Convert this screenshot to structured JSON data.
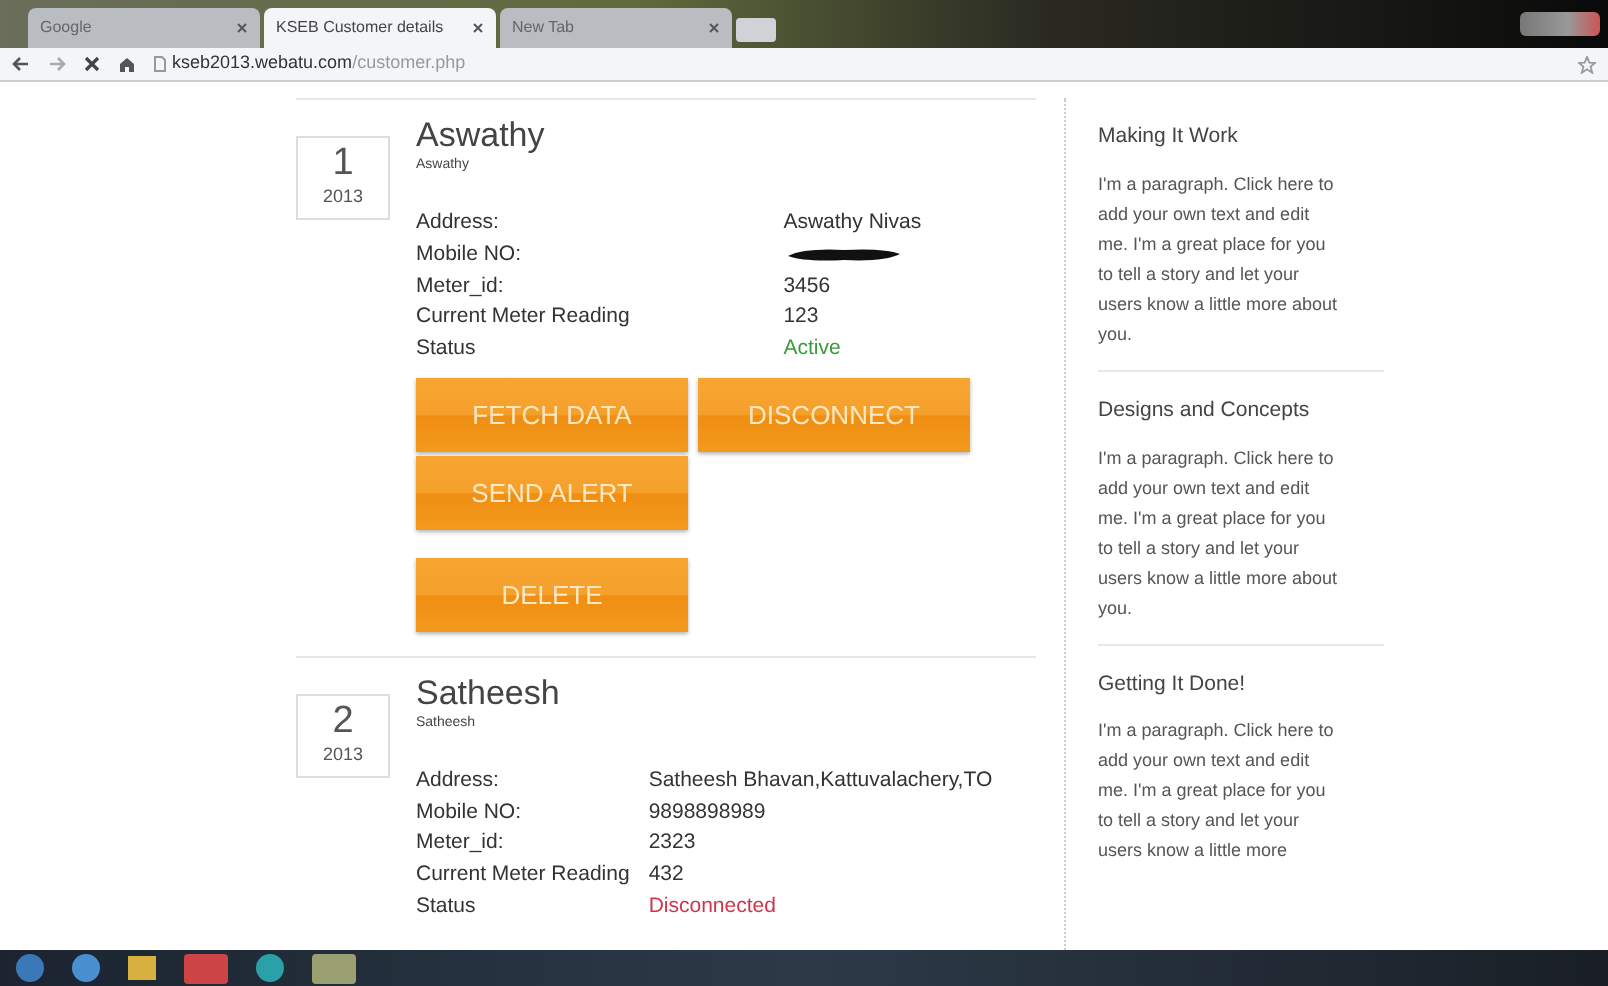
{
  "browser": {
    "tabs": [
      {
        "label": "Google",
        "selected": false
      },
      {
        "label": "KSEB Customer details",
        "selected": true
      },
      {
        "label": "New Tab",
        "selected": false
      }
    ],
    "address": {
      "host": "kseb2013.webatu.com",
      "path": "/customer.php"
    }
  },
  "customers": [
    {
      "number": "1",
      "year": "2013",
      "name": "Aswathy",
      "subname": "Aswathy",
      "fields": [
        {
          "label": "Address:",
          "value": "Aswathy Nivas",
          "kind": "text"
        },
        {
          "label": "Mobile NO:",
          "kind": "redacted"
        },
        {
          "label": "Meter_id:",
          "value": "3456",
          "kind": "text"
        },
        {
          "label": "Current Meter Reading",
          "value": "123",
          "kind": "text"
        },
        {
          "label": "Status",
          "value": "Active",
          "kind": "active"
        }
      ],
      "buttons": [
        "FETCH DATA",
        "DISCONNECT",
        "SEND ALERT",
        "DELETE"
      ]
    },
    {
      "number": "2",
      "year": "2013",
      "name": "Satheesh",
      "subname": "Satheesh",
      "fields": [
        {
          "label": "Address:",
          "value": "Satheesh Bhavan,Kattuvalachery,TO",
          "kind": "text"
        },
        {
          "label": "Mobile NO:",
          "value": "9898898989",
          "kind": "text"
        },
        {
          "label": "Meter_id:",
          "value": "2323",
          "kind": "text"
        },
        {
          "label": "Current Meter Reading",
          "value": "432",
          "kind": "text"
        },
        {
          "label": "Status",
          "value": "Disconnected",
          "kind": "disconnected"
        }
      ]
    }
  ],
  "sidebar": [
    {
      "title": "Making It Work",
      "text": "I'm a paragraph. Click here to add your own text and edit me. I'm a great place for you to tell a story and let your users know a little more about you."
    },
    {
      "title": "Designs and Concepts",
      "text": "I'm a paragraph. Click here to add your own text and edit me. I'm a great place for you to tell a story and let your users know a little more about you."
    },
    {
      "title": "Getting It Done!",
      "text": "I'm a paragraph. Click here to add your own text and edit me. I'm a great place for you to tell a story and let your users know a little more"
    }
  ]
}
